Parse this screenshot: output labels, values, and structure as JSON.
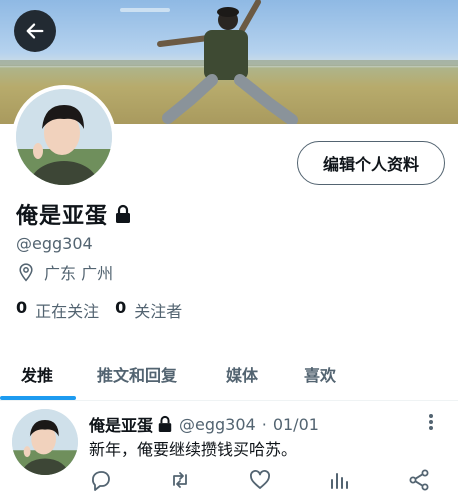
{
  "header": {
    "back_icon": "arrow-left-icon"
  },
  "profile": {
    "edit_button_label": "编辑个人资料",
    "display_name": "俺是亚蛋",
    "handle": "@egg304",
    "location": "广东 广州",
    "following_count": "0",
    "following_label": "正在关注",
    "followers_count": "0",
    "followers_label": "关注者"
  },
  "tabs": [
    {
      "label": "发推",
      "active": true
    },
    {
      "label": "推文和回复",
      "active": false
    },
    {
      "label": "媒体",
      "active": false
    },
    {
      "label": "喜欢",
      "active": false
    }
  ],
  "tweet": {
    "name": "俺是亚蛋",
    "handle": "@egg304",
    "separator": "·",
    "date": "01/01",
    "text": "新年，俺要继续攒钱买哈苏。",
    "actions": [
      "reply-icon",
      "retweet-icon",
      "like-icon",
      "analytics-icon",
      "share-icon"
    ]
  },
  "colors": {
    "accent": "#1d9bf0",
    "text": "#0f1419",
    "secondary": "#536471"
  }
}
